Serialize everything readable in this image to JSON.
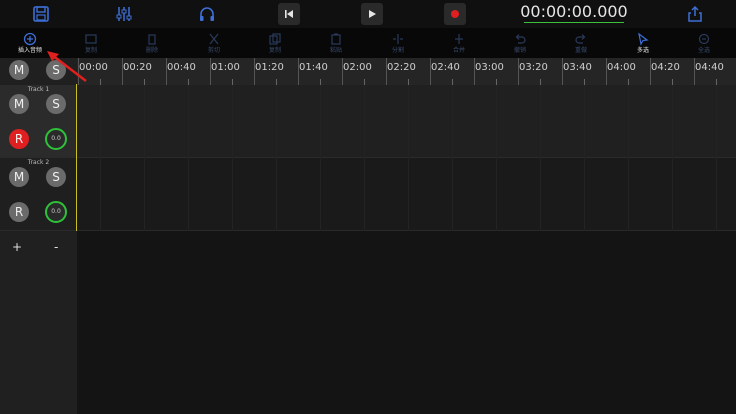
{
  "topbar": {
    "timecode": "00:00:00.000",
    "icons": [
      "save-icon",
      "mixer-icon",
      "headphones-icon",
      "skip-back-icon",
      "play-icon",
      "record-icon",
      "share-icon"
    ]
  },
  "toolbar": {
    "items": [
      {
        "label": "插入音频",
        "icon": "insert-audio-icon",
        "active": true
      },
      {
        "label": "复制",
        "icon": "copy-icon",
        "active": false
      },
      {
        "label": "删除",
        "icon": "delete-icon",
        "active": false
      },
      {
        "label": "剪切",
        "icon": "cut-icon",
        "active": false
      },
      {
        "label": "复制",
        "icon": "duplicate-icon",
        "active": false
      },
      {
        "label": "粘贴",
        "icon": "paste-icon",
        "active": false
      },
      {
        "label": "分割",
        "icon": "split-icon",
        "active": false
      },
      {
        "label": "合并",
        "icon": "merge-icon",
        "active": false
      },
      {
        "label": "撤销",
        "icon": "undo-icon",
        "active": false
      },
      {
        "label": "重做",
        "icon": "redo-icon",
        "active": false
      },
      {
        "label": "多选",
        "icon": "multiselect-icon",
        "active": true
      },
      {
        "label": "全选",
        "icon": "select-all-icon",
        "active": false
      }
    ]
  },
  "master": {
    "mute": "M",
    "solo": "S"
  },
  "ruler": {
    "labels": [
      "00:00",
      "00:20",
      "00:40",
      "01:00",
      "01:20",
      "01:40",
      "02:00",
      "02:20",
      "02:40",
      "03:00",
      "03:20",
      "03:40",
      "04:00",
      "04:20",
      "04:40"
    ]
  },
  "tracks": [
    {
      "name": "Track 1",
      "mute": "M",
      "solo": "S",
      "record": "R",
      "volume": "0.0",
      "armed": true
    },
    {
      "name": "Track 2",
      "mute": "M",
      "solo": "S",
      "record": "R",
      "volume": "0.0",
      "armed": false
    }
  ],
  "track_controls": {
    "add": "+",
    "remove": "-"
  },
  "colors": {
    "accent_green": "#2ec13a",
    "record_red": "#e02020",
    "toolbar_blue": "#3d6fd6",
    "playhead": "#c8c020"
  }
}
